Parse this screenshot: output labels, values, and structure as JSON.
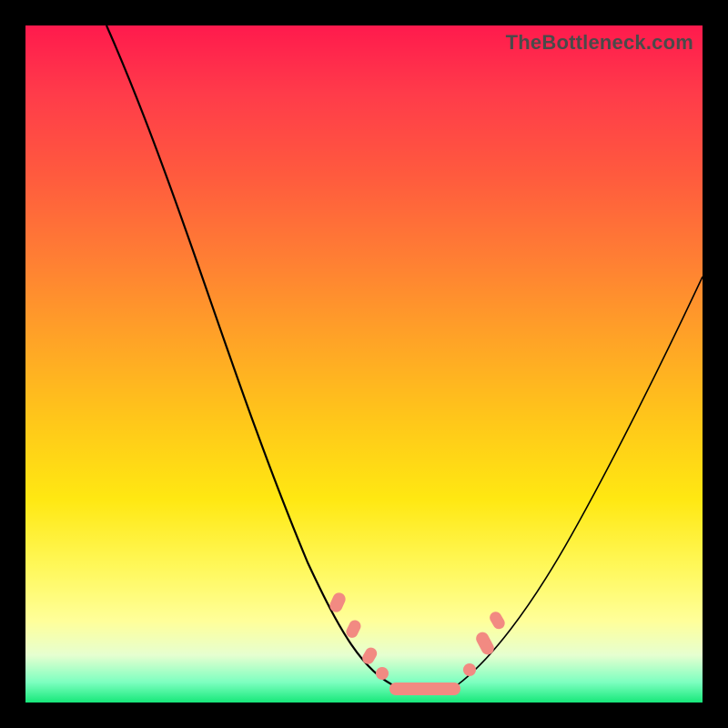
{
  "watermark": "TheBottleneck.com",
  "chart_data": {
    "type": "line",
    "title": "",
    "xlabel": "",
    "ylabel": "",
    "xlim": [
      0,
      100
    ],
    "ylim": [
      0,
      100
    ],
    "grid": false,
    "series": [
      {
        "name": "left-curve",
        "x": [
          12,
          16,
          20,
          24,
          28,
          31,
          34,
          37,
          40,
          43,
          46,
          49,
          51,
          53,
          55
        ],
        "y": [
          100,
          88,
          77,
          66,
          55,
          46,
          38,
          31,
          25,
          19,
          15,
          10,
          7,
          4,
          2
        ]
      },
      {
        "name": "right-curve",
        "x": [
          63,
          66,
          69,
          73,
          77,
          81,
          85,
          89,
          93,
          97,
          100
        ],
        "y": [
          2,
          5,
          9,
          14,
          20,
          27,
          34,
          41,
          49,
          57,
          63
        ]
      }
    ],
    "flat_segment": {
      "x_start": 55,
      "x_end": 63,
      "y": 2
    },
    "markers": [
      {
        "x": 46,
        "y": 15
      },
      {
        "x": 49,
        "y": 10
      },
      {
        "x": 51,
        "y": 7
      },
      {
        "x": 67,
        "y": 10
      },
      {
        "x": 68,
        "y": 12
      }
    ],
    "colors": {
      "marker": "#f28a82",
      "curve": "#000000",
      "frame": "#000000"
    }
  }
}
